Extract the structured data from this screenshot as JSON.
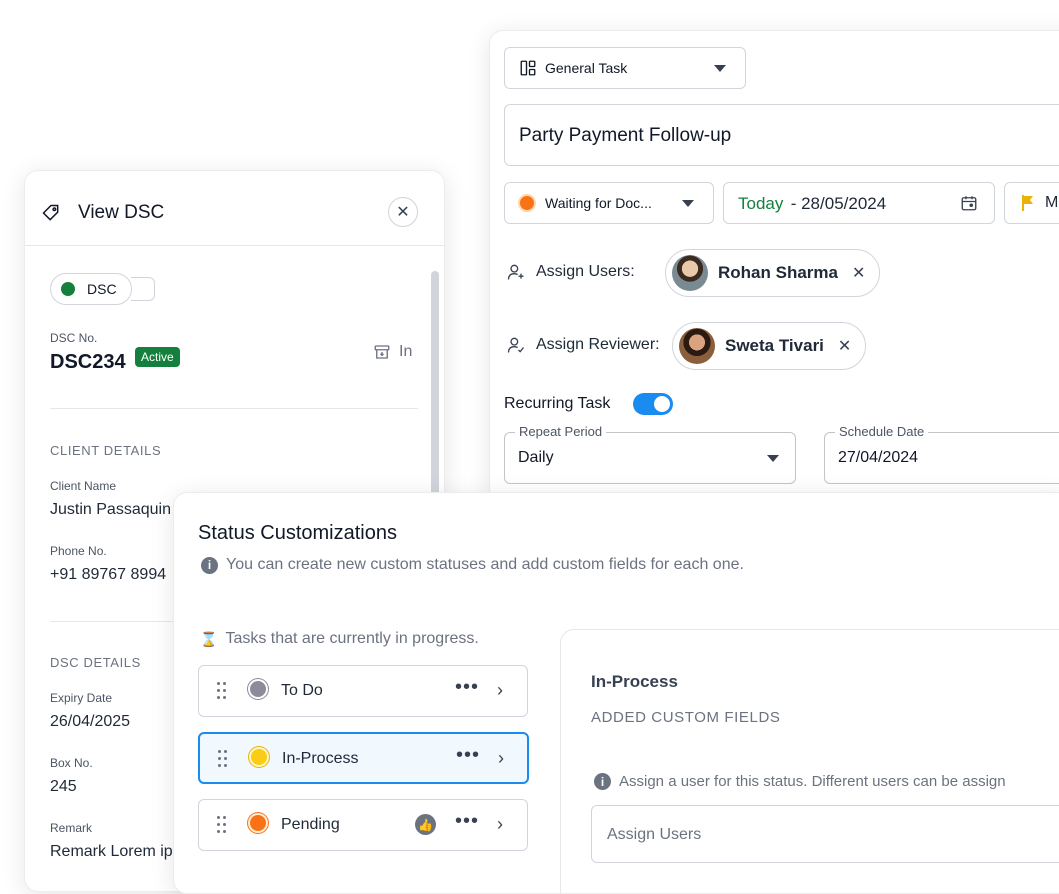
{
  "dsc_panel": {
    "title": "View DSC",
    "toggle_label": "DSC",
    "dsc_no_label": "DSC No.",
    "dsc_no": "DSC234",
    "status_badge": "Active",
    "inbox_label": "In",
    "client_section": "CLIENT DETAILS",
    "client_name_label": "Client Name",
    "client_name": "Justin Passaquin",
    "phone_label": "Phone No.",
    "phone": "+91 89767 8994",
    "dsc_section": "DSC DETAILS",
    "expiry_label": "Expiry Date",
    "expiry": "26/04/2025",
    "box_label": "Box No.",
    "box": "245",
    "remark_label": "Remark",
    "remark": "Remark Lorem ip"
  },
  "task_panel": {
    "task_type": "General Task",
    "task_title": "Party Payment Follow-up",
    "status": "Waiting for Doc...",
    "date_prefix": "Today",
    "date_value": " - 28/05/2024",
    "priority": "Me",
    "assign_users_label": "Assign Users:",
    "assigned_user": "Rohan Sharma",
    "assign_reviewer_label": "Assign Reviewer:",
    "reviewer": "Sweta Tivari",
    "recurring_label": "Recurring Task",
    "recurring_enabled": true,
    "repeat_period_label": "Repeat Period",
    "repeat_period": "Daily",
    "schedule_date_label": "Schedule Date",
    "schedule_date": "27/04/2024"
  },
  "status_panel": {
    "title": "Status Customizations",
    "info": "You can create new custom statuses and add custom fields for each one.",
    "group_label": "Tasks that are currently in progress.",
    "statuses": [
      {
        "name": "To Do",
        "color": "#8b8b99"
      },
      {
        "name": "In-Process",
        "color": "#facc15"
      },
      {
        "name": "Pending",
        "color": "#f97316"
      }
    ],
    "detail_title": "In-Process",
    "detail_subtitle": "ADDED CUSTOM FIELDS",
    "assign_hint": "Assign a user for this status. Different users can be assign",
    "assign_placeholder": "Assign Users"
  },
  "colors": {
    "accent": "#1a8cf0",
    "active_green": "#15803d",
    "today_green": "#15803d"
  }
}
